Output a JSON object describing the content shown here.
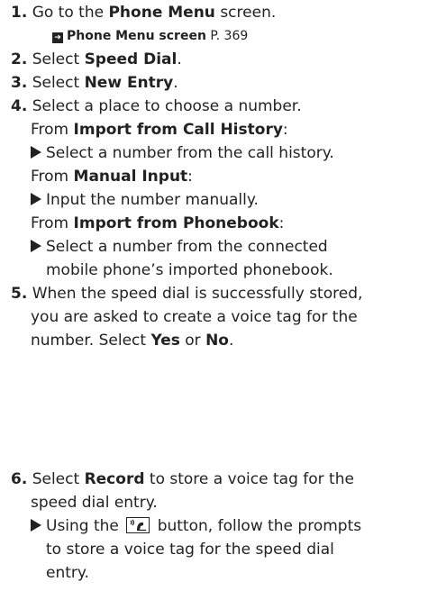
{
  "steps": [
    {
      "num": "1.",
      "pre": "Go to the ",
      "bold": "Phone Menu",
      "post": " screen."
    },
    {
      "num": "2.",
      "pre": "Select ",
      "bold": "Speed Dial",
      "post": "."
    },
    {
      "num": "3.",
      "pre": "Select ",
      "bold": "New Entry",
      "post": "."
    },
    {
      "num": "4.",
      "text": "Select a place to choose a number."
    },
    {
      "num": "5.",
      "text": "When the speed dial is successfully stored,"
    },
    {
      "num": "6.",
      "pre": "Select ",
      "bold": "Record",
      "post": " to store a voice tag for the"
    }
  ],
  "reference": {
    "title": "Phone Menu screen",
    "page": "P. 369",
    "icon": "arrow-ref-icon"
  },
  "options": [
    {
      "from": "From ",
      "name": "Import from Call History",
      "colon": ":",
      "detail": "Select a number from the call history."
    },
    {
      "from": "From ",
      "name": "Manual Input",
      "colon": ":",
      "detail": "Input the number manually."
    },
    {
      "from": "From ",
      "name": "Import from Phonebook",
      "colon": ":",
      "detail_1": "Select a number from the connected",
      "detail_2": "mobile phone’s imported phonebook."
    }
  ],
  "step5_cont": {
    "line2": "you are asked to create a voice tag for the",
    "line3_pre": "number. Select ",
    "yes": "Yes",
    "or": " or ",
    "no": "No",
    "end": "."
  },
  "step6_cont": {
    "line2": "speed dial entry.",
    "sub_pre": "Using the ",
    "button_icon": "voice-tag-button-icon",
    "sub_post": " button, follow the prompts",
    "sub_line2": "to store a voice tag for the speed dial",
    "sub_line3": "entry."
  }
}
